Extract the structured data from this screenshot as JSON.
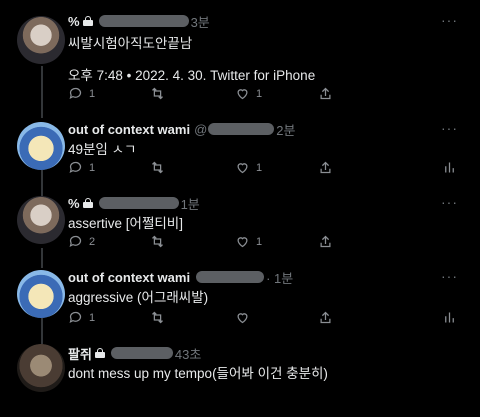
{
  "tweets": [
    {
      "name": "%",
      "time": "3분",
      "text": "씨발시험아직도안끝남",
      "meta": "오후 7:48 • 2022. 4. 30. Twitter for iPhone",
      "reply_count": "1",
      "retweet_count": "",
      "like_count": "1"
    },
    {
      "name": "out of context wami",
      "handle_prefix": "@",
      "time": "2분",
      "text": "49분임 ㅅㄱ",
      "reply_count": "1",
      "retweet_count": "",
      "like_count": "1"
    },
    {
      "name": "%",
      "time": "1분",
      "text": "assertive [어쩔티비]",
      "reply_count": "2",
      "retweet_count": "",
      "like_count": "1"
    },
    {
      "name": "out of context wami",
      "time": "· 1분",
      "text": "aggressive (어그래씨발)",
      "reply_count": "1",
      "retweet_count": "",
      "like_count": ""
    },
    {
      "name": "팔쥐",
      "time": "43초",
      "text": "dont mess up my tempo(들어봐 이건 충분히)",
      "reply_count": "",
      "retweet_count": "",
      "like_count": ""
    }
  ],
  "icons": [
    "reply-icon",
    "retweet-icon",
    "like-icon",
    "share-icon",
    "analytics-icon",
    "more-icon",
    "lock-icon"
  ],
  "colors": {
    "background": "#000000",
    "text": "#e7e9ea",
    "muted": "#71767b",
    "redaction": "#5c5f63"
  }
}
